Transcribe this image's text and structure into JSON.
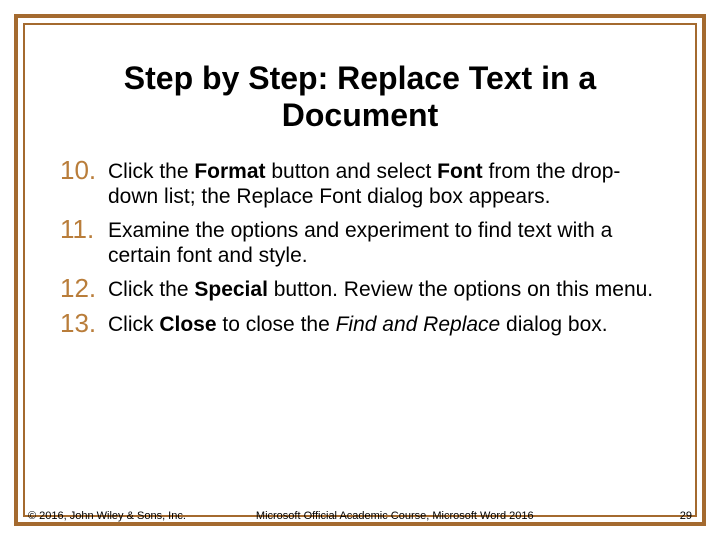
{
  "title": "Step by Step: Replace Text in a Document",
  "steps": [
    {
      "n": "10.",
      "html": "Click the <b>Format</b> button and select <b>Font</b> from the drop-down list; the Replace Font dialog box appears."
    },
    {
      "n": "11.",
      "html": "Examine the options and experiment to find text with a certain font and style."
    },
    {
      "n": "12.",
      "html": "Click the <b>Special</b> button. Review the options on this menu."
    },
    {
      "n": "13.",
      "html": "Click <b>Close</b> to close the <i>Find and Replace</i> dialog box."
    }
  ],
  "footer": {
    "copyright": "© 2016, John Wiley & Sons, Inc.",
    "course": "Microsoft Official Academic Course, Microsoft Word 2016",
    "page": "29"
  }
}
